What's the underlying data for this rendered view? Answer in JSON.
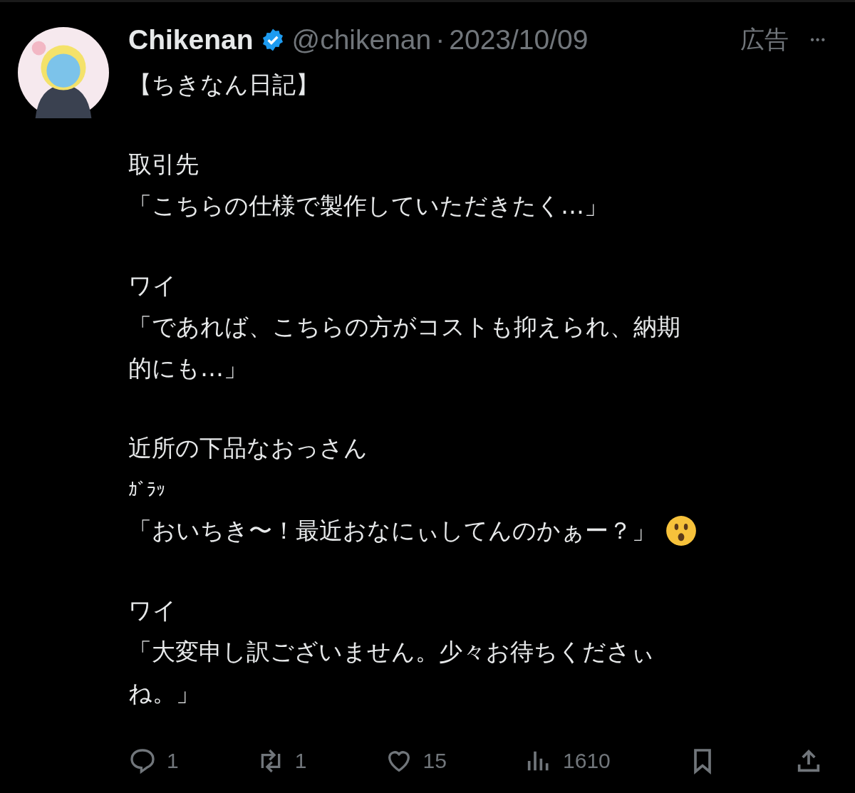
{
  "post": {
    "author": "Chikenan",
    "verified": true,
    "handle": "@chikenan",
    "separator": "·",
    "date": "2023/10/09",
    "ad_label": "広告",
    "more": "•••",
    "paragraphs": [
      [
        {
          "text": "【ちきなん日記】"
        }
      ],
      [
        {
          "text": "取引先"
        },
        {
          "text": "「こちらの仕様で製作していただきたく…」"
        }
      ],
      [
        {
          "text": "ワイ"
        },
        {
          "text": "「であれば、こちらの方がコストも抑えられ、納期"
        },
        {
          "text": "的にも…」"
        }
      ],
      [
        {
          "text": "近所の下品なおっさん"
        },
        {
          "text": "ｶﾞﾗｯ",
          "kind": "small"
        },
        {
          "text": "「おいちき〜！最近おなにぃしてんのかぁー？」",
          "kind": "emoji"
        }
      ],
      [
        {
          "text": "ワイ"
        },
        {
          "text": "「大変申し訳ございません。少々お待ちくださぃ"
        },
        {
          "text": "ね。」"
        }
      ]
    ],
    "actions": [
      {
        "kind": "reply",
        "count": "1"
      },
      {
        "kind": "repost",
        "count": "1"
      },
      {
        "kind": "like",
        "count": "15"
      },
      {
        "kind": "views",
        "count": "1610"
      },
      {
        "kind": "bookmark"
      },
      {
        "kind": "share"
      }
    ]
  }
}
